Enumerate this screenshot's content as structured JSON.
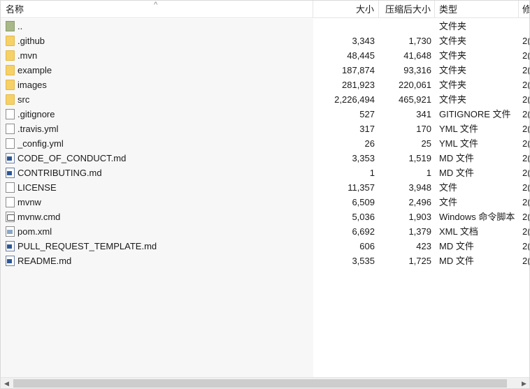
{
  "columns": {
    "name": "名称",
    "size": "大小",
    "compressed": "压缩后大小",
    "type": "类型",
    "modified": "修",
    "sort_arrow": "^"
  },
  "rows": [
    {
      "name": "..",
      "size": "",
      "compressed": "",
      "type": "文件夹",
      "modified": "",
      "icon": "folder-up-icon"
    },
    {
      "name": ".github",
      "size": "3,343",
      "compressed": "1,730",
      "type": "文件夹",
      "modified": "2(",
      "icon": "folder-icon"
    },
    {
      "name": ".mvn",
      "size": "48,445",
      "compressed": "41,648",
      "type": "文件夹",
      "modified": "2(",
      "icon": "folder-icon"
    },
    {
      "name": "example",
      "size": "187,874",
      "compressed": "93,316",
      "type": "文件夹",
      "modified": "2(",
      "icon": "folder-icon"
    },
    {
      "name": "images",
      "size": "281,923",
      "compressed": "220,061",
      "type": "文件夹",
      "modified": "2(",
      "icon": "folder-icon"
    },
    {
      "name": "src",
      "size": "2,226,494",
      "compressed": "465,921",
      "type": "文件夹",
      "modified": "2(",
      "icon": "folder-icon"
    },
    {
      "name": ".gitignore",
      "size": "527",
      "compressed": "341",
      "type": "GITIGNORE 文件",
      "modified": "2(",
      "icon": "file-icon"
    },
    {
      "name": ".travis.yml",
      "size": "317",
      "compressed": "170",
      "type": "YML 文件",
      "modified": "2(",
      "icon": "file-icon"
    },
    {
      "name": "_config.yml",
      "size": "26",
      "compressed": "25",
      "type": "YML 文件",
      "modified": "2(",
      "icon": "file-icon"
    },
    {
      "name": "CODE_OF_CONDUCT.md",
      "size": "3,353",
      "compressed": "1,519",
      "type": "MD 文件",
      "modified": "2(",
      "icon": "doc-icon"
    },
    {
      "name": "CONTRIBUTING.md",
      "size": "1",
      "compressed": "1",
      "type": "MD 文件",
      "modified": "2(",
      "icon": "doc-icon"
    },
    {
      "name": "LICENSE",
      "size": "11,357",
      "compressed": "3,948",
      "type": "文件",
      "modified": "2(",
      "icon": "file-icon"
    },
    {
      "name": "mvnw",
      "size": "6,509",
      "compressed": "2,496",
      "type": "文件",
      "modified": "2(",
      "icon": "file-icon"
    },
    {
      "name": "mvnw.cmd",
      "size": "5,036",
      "compressed": "1,903",
      "type": "Windows 命令脚本",
      "modified": "2(",
      "icon": "cmd-icon"
    },
    {
      "name": "pom.xml",
      "size": "6,692",
      "compressed": "1,379",
      "type": "XML 文档",
      "modified": "2(",
      "icon": "xml-icon"
    },
    {
      "name": "PULL_REQUEST_TEMPLATE.md",
      "size": "606",
      "compressed": "423",
      "type": "MD 文件",
      "modified": "2(",
      "icon": "doc-icon"
    },
    {
      "name": "README.md",
      "size": "3,535",
      "compressed": "1,725",
      "type": "MD 文件",
      "modified": "2(",
      "icon": "doc-icon"
    }
  ],
  "scrollbar": {
    "left_arrow": "◀",
    "right_arrow": "▶"
  }
}
